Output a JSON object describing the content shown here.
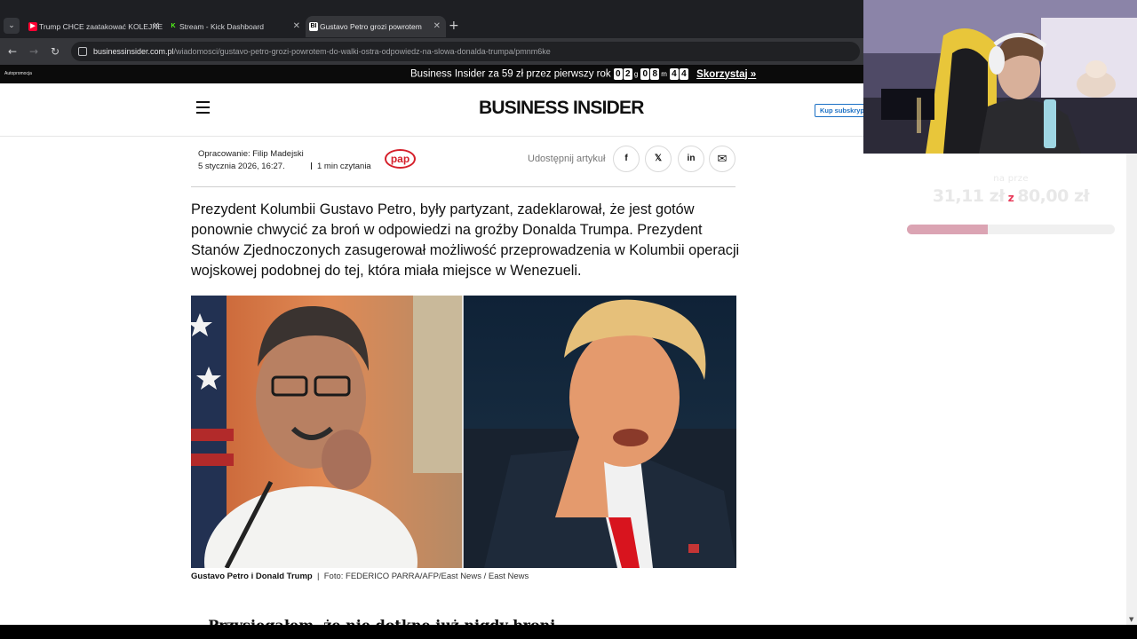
{
  "browser": {
    "tabs": [
      {
        "title": "Trump CHCE zaatakować KOLEJNE",
        "favicon": "youtube-icon",
        "color": "#ff0033"
      },
      {
        "title": "Stream - Kick Dashboard",
        "favicon": "kick-icon",
        "color": "#53fc18"
      },
      {
        "title": "Gustavo Petro grozi powrotem",
        "favicon": "bi-icon",
        "color": "#ffffff"
      }
    ],
    "url_host": "businessinsider.com.pl",
    "url_path": "/wiadomosci/gustavo-petro-grozi-powrotem-do-walki-ostra-odpowiedz-na-slowa-donalda-trumpa/pmnm6ke"
  },
  "promo": {
    "tag": "Autopromocja",
    "text": "Business Insider za 59 zł przez pierwszy rok",
    "countdown": [
      {
        "digits": [
          "0",
          "2"
        ],
        "unit": "g"
      },
      {
        "digits": [
          "0",
          "8"
        ],
        "unit": "m"
      },
      {
        "digits": [
          "4",
          "4"
        ],
        "unit": ""
      }
    ],
    "cta": "Skorzystaj »"
  },
  "header": {
    "logo": "BUSINESS INSIDER",
    "subscribe": "Kup subskrypcję"
  },
  "article": {
    "author_line": "Opracowanie: Filip Madejski",
    "date": "5 stycznia 2026, 16:27.",
    "read_time": "1 min czytania",
    "source_badge": "pap",
    "share_label": "Udostępnij artykuł",
    "share_buttons": [
      {
        "name": "facebook",
        "glyph": "f"
      },
      {
        "name": "x",
        "glyph": "𝕏"
      },
      {
        "name": "linkedin",
        "glyph": "in"
      },
      {
        "name": "email",
        "glyph": "✉"
      }
    ],
    "lead": "Prezydent Kolumbii Gustavo Petro, były partyzant, zadeklarował, że jest gotów ponownie chwycić za broń w odpowiedzi na groźby Donalda Trumpa. Prezydent Stanów Zjednoczonych zasugerował możliwość przeprowadzenia w Kolumbii operacji wojskowej podobnej do tej, która miała miejsce w Wenezueli.",
    "caption_title": "Gustavo Petro i Donald Trump",
    "caption_separator": "|",
    "caption_credit": "Foto: FEDERICO PARRA/AFP/East News / East News",
    "next_paragraph_peek": "„Przysięgałem, że nie dotknę już nigdy broni..."
  },
  "stream_overlay": {
    "label": "na prze",
    "current": "31,11 zł",
    "separator": "z",
    "goal": "80,00 zł",
    "progress": 0.39,
    "bar_color": "#dba4b3"
  }
}
